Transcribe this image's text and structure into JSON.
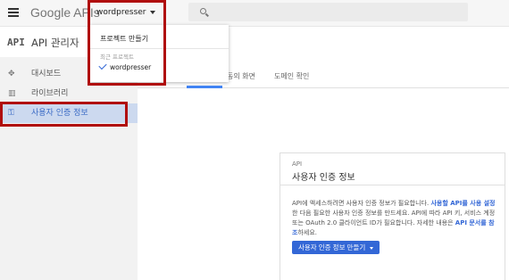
{
  "header": {
    "logo_google": "Google",
    "logo_apis": "APIs",
    "project_name": "wordpresser",
    "search_placeholder": ""
  },
  "page": {
    "api_logo": "API",
    "title": "API 관리자"
  },
  "sidebar": {
    "items": [
      {
        "label": "대시보드",
        "icon": "dashboard-icon"
      },
      {
        "label": "라이브러리",
        "icon": "library-icon"
      },
      {
        "label": "사용자 인증 정보",
        "icon": "key-icon"
      }
    ]
  },
  "tabs": [
    {
      "label": "동의 화면"
    },
    {
      "label": "도메인 확인"
    }
  ],
  "dropdown": {
    "create_project": "프로젝트 만들기",
    "recent_projects": "최근 프로젝트",
    "project_item": "wordpresser"
  },
  "card": {
    "label": "API",
    "title": "사용자 인증 정보",
    "desc_part1": "API에 액세스하려면 사용자 인증 정보가 필요합니다.",
    "desc_link1": "사용할 API를 사용 설정",
    "desc_part2": "한 다음 필요한 사용자 인증 정보를 만드세요. API에 따라 API 키, 서비스 계정 또는 OAuth 2.0 클라이언트 ID가 필요합니다. 자세한 내용은",
    "desc_link2": "API 문서를 참조",
    "desc_part3": "하세요.",
    "button_label": "사용자 인증 정보 만들기"
  },
  "colors": {
    "accent": "#3367d6",
    "highlight": "#b00d0d",
    "active_sidebar": "#ccd9ef"
  }
}
